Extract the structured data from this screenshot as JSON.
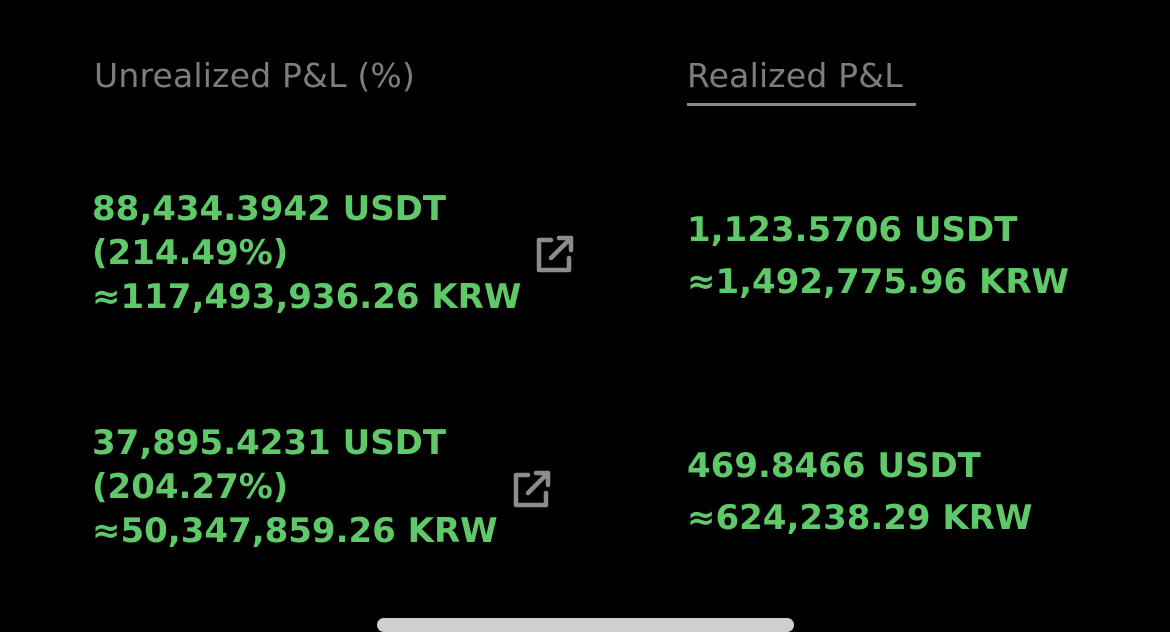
{
  "headers": {
    "unrealized_label": "Unrealized P&L (%)",
    "realized_label": "Realized P&L"
  },
  "positions": [
    {
      "unrealized_usdt": "88,434.3942 USDT",
      "unrealized_percent": "(214.49%)",
      "unrealized_krw": "≈117,493,936.26 KRW",
      "realized_usdt": "1,123.5706 USDT",
      "realized_krw": "≈1,492,775.96 KRW"
    },
    {
      "unrealized_usdt": "37,895.4231 USDT",
      "unrealized_percent": "(204.27%)",
      "unrealized_krw": "≈50,347,859.26 KRW",
      "realized_usdt": "469.8466 USDT",
      "realized_krw": "≈624,238.29 KRW"
    }
  ],
  "icons": {
    "share": "external-link-icon"
  },
  "colors": {
    "background": "#000000",
    "profit": "#5fc96a",
    "header": "#7d7d7d"
  }
}
